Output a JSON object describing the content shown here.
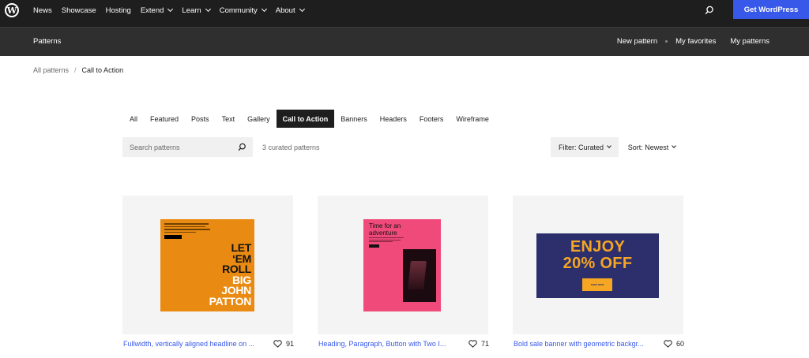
{
  "topnav": {
    "items": [
      {
        "label": "News",
        "dropdown": false
      },
      {
        "label": "Showcase",
        "dropdown": false
      },
      {
        "label": "Hosting",
        "dropdown": false
      },
      {
        "label": "Extend",
        "dropdown": true
      },
      {
        "label": "Learn",
        "dropdown": true
      },
      {
        "label": "Community",
        "dropdown": true
      },
      {
        "label": "About",
        "dropdown": true
      }
    ],
    "cta_label": "Get WordPress",
    "cta_color": "#3858e9"
  },
  "subbar": {
    "title": "Patterns",
    "links": [
      "New pattern",
      "My favorites",
      "My patterns"
    ]
  },
  "breadcrumb": {
    "parent": "All patterns",
    "separator": "/",
    "current": "Call to Action"
  },
  "tabs": {
    "items": [
      "All",
      "Featured",
      "Posts",
      "Text",
      "Gallery",
      "Call to Action",
      "Banners",
      "Headers",
      "Footers",
      "Wireframe"
    ],
    "active": "Call to Action"
  },
  "search": {
    "placeholder": "Search patterns",
    "value": ""
  },
  "results": {
    "count_text": "3 curated patterns"
  },
  "filter": {
    "label": "Filter: Curated"
  },
  "sort": {
    "label": "Sort: Newest"
  },
  "cards": [
    {
      "title": "Fullwidth, vertically aligned headline on ...",
      "likes": "91",
      "preview": {
        "bg": "#e98b12",
        "lines_dark": [
          "LET",
          "‘EM",
          "ROLL"
        ],
        "lines_light": [
          "BIG",
          "JOHN",
          "PATTON"
        ]
      }
    },
    {
      "title": "Heading, Paragraph, Button with Two I...",
      "likes": "71",
      "preview": {
        "bg": "#f04a7b",
        "heading": "Time for an adventure"
      }
    },
    {
      "title": "Bold sale banner with geometric backgr...",
      "likes": "60",
      "preview": {
        "bg": "#2d2f6c",
        "line1": "ENJOY",
        "line2": "20% OFF",
        "button": "SHOP NOW"
      }
    }
  ]
}
